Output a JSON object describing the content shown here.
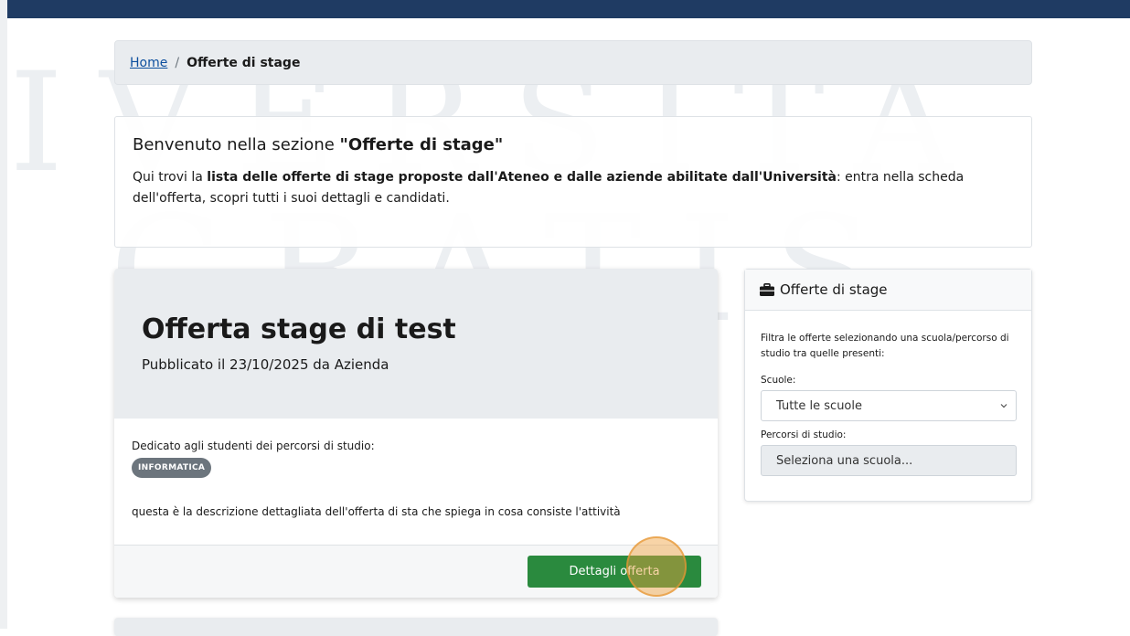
{
  "breadcrumb": {
    "home": "Home",
    "separator": "/",
    "current": "Offerte di stage"
  },
  "intro": {
    "title_prefix": "Benvenuto nella sezione ",
    "title_bold": "\"Offerte di stage\"",
    "text_prefix": "Qui trovi la ",
    "text_bold": "lista delle offerte di stage proposte dall'Ateneo e dalle aziende abilitate dall'Università",
    "text_suffix": ": entra nella scheda dell'offerta, scopri tutti i suoi dettagli e candidati."
  },
  "offer": {
    "title": "Offerta stage di test",
    "published": "Pubblicato il 23/10/2025 da Azienda",
    "dedicated_label": "Dedicato agli studenti dei percorsi di studio:",
    "badge": "INFORMATICA",
    "description": "questa è la descrizione dettagliata dell'offerta di sta che spiega in cosa consiste l'attività",
    "button_label": "Dettagli offerta"
  },
  "filter": {
    "title": "Offerte di stage",
    "intro": "Filtra le offerte selezionando una scuola/percorso di studio tra quelle presenti:",
    "schools_label": "Scuole:",
    "schools_value": "Tutte le scuole",
    "paths_label": "Percorsi di studio:",
    "paths_placeholder": "Seleziona una scuola..."
  },
  "colors": {
    "topbar": "#1f3b63",
    "button": "#2a8a3e",
    "badge": "#6c757d"
  }
}
